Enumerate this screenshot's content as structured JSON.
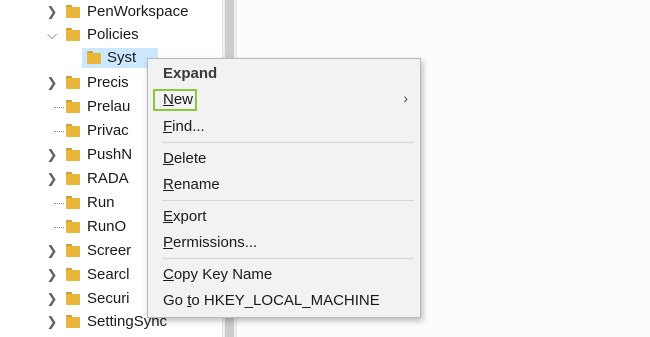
{
  "tree": {
    "items": [
      {
        "expander": ">",
        "label": "PenWorkspace"
      },
      {
        "expander": "v",
        "label": "Policies"
      },
      {
        "expander": "",
        "label": "Syst"
      },
      {
        "expander": ">",
        "label": "Precis"
      },
      {
        "expander": "",
        "label": "Prelau"
      },
      {
        "expander": "",
        "label": "Privac"
      },
      {
        "expander": ">",
        "label": "PushN"
      },
      {
        "expander": ">",
        "label": "RADA"
      },
      {
        "expander": "",
        "label": "Run"
      },
      {
        "expander": "",
        "label": "RunO"
      },
      {
        "expander": ">",
        "label": "Screer"
      },
      {
        "expander": ">",
        "label": "Searcl"
      },
      {
        "expander": ">",
        "label": "Securi"
      },
      {
        "expander": ">",
        "label": "SettingSync"
      }
    ]
  },
  "context_menu": {
    "items": {
      "expand": "Expand",
      "new_first": "N",
      "new_rest": "ew",
      "find_first": "F",
      "find_rest": "ind...",
      "delete_first": "D",
      "delete_rest": "elete",
      "rename_first": "R",
      "rename_rest": "ename",
      "export_first": "E",
      "export_rest": "xport",
      "permissions_first": "P",
      "permissions_rest": "ermissions...",
      "copy_first": "C",
      "copy_rest": "opy Key Name",
      "goto_pre": "Go ",
      "goto_t": "t",
      "goto_rest": "o HKEY_LOCAL_MACHINE"
    },
    "submenu_arrow": "›",
    "highlight_color": "#8dc63f"
  },
  "colors": {
    "folder": "#e9b53a",
    "selection": "#cce8ff",
    "menu_bg": "#f2f2f2"
  }
}
